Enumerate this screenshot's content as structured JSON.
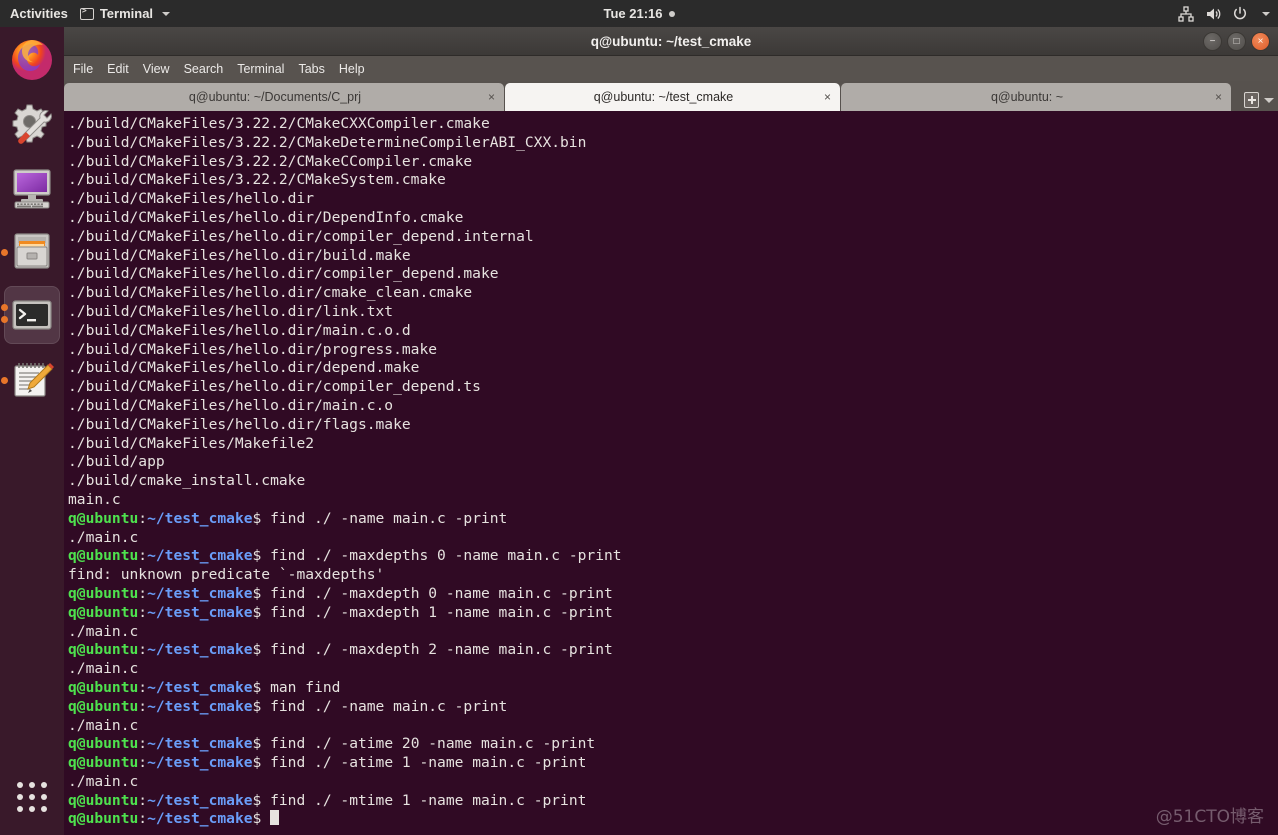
{
  "topbar": {
    "activities": "Activities",
    "app_name": "Terminal",
    "app_icon": "terminal-icon",
    "clock": "Tue 21:16",
    "indicator_icon": "notification-dot-icon",
    "sys_icons": [
      "network-icon",
      "volume-icon",
      "power-icon",
      "chevron-down-icon"
    ]
  },
  "dock": {
    "items": [
      {
        "name": "firefox",
        "icon": "firefox-icon",
        "running": false,
        "active": false,
        "dots": 0
      },
      {
        "name": "software-tools",
        "icon": "gear-wrench-icon",
        "running": false,
        "active": false,
        "dots": 0
      },
      {
        "name": "displays",
        "icon": "monitor-icon",
        "running": false,
        "active": false,
        "dots": 0
      },
      {
        "name": "files",
        "icon": "file-cabinet-icon",
        "running": true,
        "active": false,
        "dots": 1
      },
      {
        "name": "terminal",
        "icon": "terminal-icon",
        "running": true,
        "active": true,
        "dots": 2
      },
      {
        "name": "text-editor",
        "icon": "notepad-pencil-icon",
        "running": true,
        "active": false,
        "dots": 1
      }
    ],
    "show_apps_icon": "grid-dots-icon"
  },
  "window": {
    "title": "q@ubuntu: ~/test_cmake",
    "buttons": {
      "minimize": "−",
      "maximize": "□",
      "close": "×"
    },
    "menu": [
      "File",
      "Edit",
      "View",
      "Search",
      "Terminal",
      "Tabs",
      "Help"
    ],
    "tabs": [
      {
        "label": "q@ubuntu: ~/Documents/C_prj",
        "active": false,
        "close": "×"
      },
      {
        "label": "q@ubuntu: ~/test_cmake",
        "active": true,
        "close": "×"
      },
      {
        "label": "q@ubuntu: ~",
        "active": false,
        "close": "×"
      }
    ],
    "new_tab_icon": "new-tab-icon",
    "tab_menu_icon": "chevron-down-icon"
  },
  "terminal": {
    "user_host": "q@ubuntu",
    "path": "~/test_cmake",
    "prompt_sep": ":",
    "prompt_sign": "$",
    "lines": [
      {
        "type": "out",
        "text": "./build/CMakeFiles/3.22.2/CMakeCXXCompiler.cmake"
      },
      {
        "type": "out",
        "text": "./build/CMakeFiles/3.22.2/CMakeDetermineCompilerABI_CXX.bin"
      },
      {
        "type": "out",
        "text": "./build/CMakeFiles/3.22.2/CMakeCCompiler.cmake"
      },
      {
        "type": "out",
        "text": "./build/CMakeFiles/3.22.2/CMakeSystem.cmake"
      },
      {
        "type": "out",
        "text": "./build/CMakeFiles/hello.dir"
      },
      {
        "type": "out",
        "text": "./build/CMakeFiles/hello.dir/DependInfo.cmake"
      },
      {
        "type": "out",
        "text": "./build/CMakeFiles/hello.dir/compiler_depend.internal"
      },
      {
        "type": "out",
        "text": "./build/CMakeFiles/hello.dir/build.make"
      },
      {
        "type": "out",
        "text": "./build/CMakeFiles/hello.dir/compiler_depend.make"
      },
      {
        "type": "out",
        "text": "./build/CMakeFiles/hello.dir/cmake_clean.cmake"
      },
      {
        "type": "out",
        "text": "./build/CMakeFiles/hello.dir/link.txt"
      },
      {
        "type": "out",
        "text": "./build/CMakeFiles/hello.dir/main.c.o.d"
      },
      {
        "type": "out",
        "text": "./build/CMakeFiles/hello.dir/progress.make"
      },
      {
        "type": "out",
        "text": "./build/CMakeFiles/hello.dir/depend.make"
      },
      {
        "type": "out",
        "text": "./build/CMakeFiles/hello.dir/compiler_depend.ts"
      },
      {
        "type": "out",
        "text": "./build/CMakeFiles/hello.dir/main.c.o"
      },
      {
        "type": "out",
        "text": "./build/CMakeFiles/hello.dir/flags.make"
      },
      {
        "type": "out",
        "text": "./build/CMakeFiles/Makefile2"
      },
      {
        "type": "out",
        "text": "./build/app"
      },
      {
        "type": "out",
        "text": "./build/cmake_install.cmake"
      },
      {
        "type": "out",
        "text": "main.c"
      },
      {
        "type": "cmd",
        "text": " find ./ -name main.c -print"
      },
      {
        "type": "out",
        "text": "./main.c"
      },
      {
        "type": "cmd",
        "text": " find ./ -maxdepths 0 -name main.c -print"
      },
      {
        "type": "out",
        "text": "find: unknown predicate `-maxdepths'"
      },
      {
        "type": "cmd",
        "text": " find ./ -maxdepth 0 -name main.c -print"
      },
      {
        "type": "cmd",
        "text": " find ./ -maxdepth 1 -name main.c -print"
      },
      {
        "type": "out",
        "text": "./main.c"
      },
      {
        "type": "cmd",
        "text": " find ./ -maxdepth 2 -name main.c -print"
      },
      {
        "type": "out",
        "text": "./main.c"
      },
      {
        "type": "cmd",
        "text": " man find"
      },
      {
        "type": "cmd",
        "text": " find ./ -name main.c -print"
      },
      {
        "type": "out",
        "text": "./main.c"
      },
      {
        "type": "cmd",
        "text": " find ./ -atime 20 -name main.c -print"
      },
      {
        "type": "cmd",
        "text": " find ./ -atime 1 -name main.c -print"
      },
      {
        "type": "out",
        "text": "./main.c"
      },
      {
        "type": "cmd",
        "text": " find ./ -mtime 1 -name main.c -print"
      },
      {
        "type": "cursor",
        "text": ""
      }
    ]
  },
  "watermark": "@51CTO博客",
  "colors": {
    "terminal_bg": "#300a24",
    "prompt_user": "#4ee24e",
    "prompt_path": "#6a9df8",
    "text": "#e6e2df",
    "accent_close": "#df5b28",
    "running_dot": "#e8762a",
    "titlebar": "#3c3937"
  }
}
